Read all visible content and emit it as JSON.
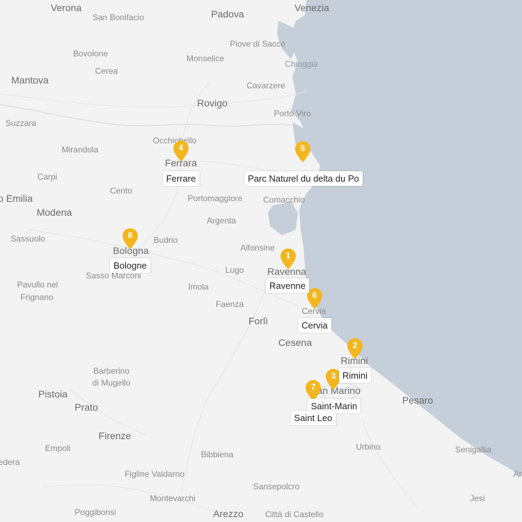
{
  "map": {
    "colors": {
      "land": "#f3f3f3",
      "sea": "#c5ced9",
      "marker": "#f3b61f",
      "marker_text": "#ffffff",
      "label_bg": "#ffffff"
    },
    "places": {
      "verona": "Verona",
      "padova": "Padova",
      "venezia": "Venezia",
      "san_bonifacio": "San Bonifacio",
      "bovolone": "Bovolone",
      "cerea": "Cerea",
      "monselice": "Monselice",
      "piove_di_sacco": "Piove di Sacco",
      "chioggia": "Chioggia",
      "mantova": "Mantova",
      "cavarzere": "Cavarzere",
      "rovigo": "Rovigo",
      "porto_viro": "Porto Viro",
      "suzzara": "Suzzara",
      "occhiobello": "Occhiobello",
      "mirandola": "Mirandola",
      "ferrara": "Ferrara",
      "carpi": "Carpi",
      "cento": "Cento",
      "portomaggiore": "Portomaggiore",
      "comacchio": "Comacchio",
      "emilia": "o Emilia",
      "modena": "Modena",
      "argenta": "Argenta",
      "sassuolo": "Sassuolo",
      "budrio": "Budrio",
      "alfonsine": "Alfonsine",
      "bologna": "Bologna",
      "sasso_marconi": "Sasso Marconi",
      "lugo": "Lugo",
      "ravenna": "Ravenna",
      "pavullo": "Pavullo nel",
      "frignano": "Frignano",
      "imola": "Imola",
      "faenza": "Faenza",
      "cervia": "Cervia",
      "forli": "Forlì",
      "cesena": "Cesena",
      "rimini": "Rimini",
      "barberino": "Barberino",
      "di_mugello": "di Mugello",
      "san_marino": "San Marino",
      "pistoia": "Pistoia",
      "prato": "Prato",
      "pesaro": "Pesaro",
      "firenze": "Firenze",
      "empoli": "Empoli",
      "urbino": "Urbino",
      "senigallia": "Senigallia",
      "bibbiena": "Bibbiena",
      "edera": "edera",
      "figline": "Figline Valdarno",
      "sansepolcro": "Sansepolcro",
      "montevarchi": "Montevarchi",
      "jesi": "Jesi",
      "an": "An",
      "poggibonsi": "Poggibonsi",
      "arezzo": "Arezzo",
      "citta_di_castello": "Città di Castello"
    },
    "markers": [
      {
        "number": "1",
        "label": "Ravenne"
      },
      {
        "number": "2",
        "label": "Rimini"
      },
      {
        "number": "3",
        "label": "Saint-Marin"
      },
      {
        "number": "4",
        "label": "Ferrare"
      },
      {
        "number": "5",
        "label": "Parc Naturel du delta du Po"
      },
      {
        "number": "6",
        "label": "Cervia"
      },
      {
        "number": "7",
        "label": "Saint Leo"
      },
      {
        "number": "8",
        "label": "Bologne"
      }
    ]
  }
}
